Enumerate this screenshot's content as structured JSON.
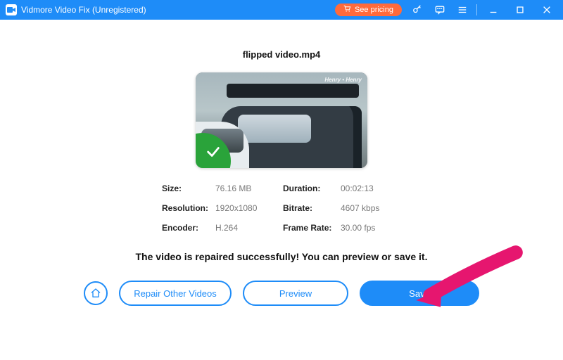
{
  "titlebar": {
    "title": "Vidmore Video Fix (Unregistered)",
    "pricing_label": "See pricing"
  },
  "file": {
    "name": "flipped video.mp4",
    "watermark": "Henry • Henry"
  },
  "meta": {
    "size_label": "Size:",
    "size_value": "76.16 MB",
    "duration_label": "Duration:",
    "duration_value": "00:02:13",
    "resolution_label": "Resolution:",
    "resolution_value": "1920x1080",
    "bitrate_label": "Bitrate:",
    "bitrate_value": "4607 kbps",
    "encoder_label": "Encoder:",
    "encoder_value": "H.264",
    "framerate_label": "Frame Rate:",
    "framerate_value": "30.00 fps"
  },
  "status_message": "The video is repaired successfully! You can preview or save it.",
  "actions": {
    "repair_other_label": "Repair Other Videos",
    "preview_label": "Preview",
    "save_label": "Save"
  },
  "colors": {
    "accent": "#1e8cf8",
    "pricing_bg": "#ff6a3b",
    "success": "#2aa33a",
    "arrow": "#e6166f"
  }
}
